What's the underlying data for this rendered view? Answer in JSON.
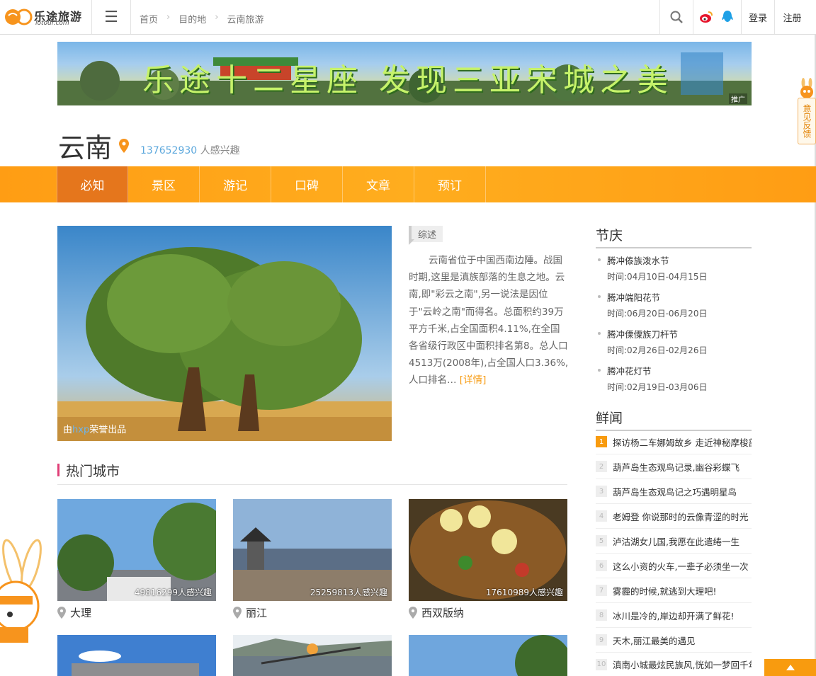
{
  "header": {
    "logo_text": "乐途旅游",
    "logo_sub": "lotour.com",
    "breadcrumb": [
      "首页",
      "目的地",
      "云南旅游"
    ],
    "login": "登录",
    "register": "注册"
  },
  "banner": {
    "text": "乐途十二星座 发现三亚宋城之美",
    "tag": "推广"
  },
  "destination": {
    "name": "云南",
    "interest_count": "137652930",
    "interest_label": "人感兴趣"
  },
  "nav": {
    "items": [
      "必知",
      "景区",
      "游记",
      "口碑",
      "文章",
      "预订"
    ],
    "active": 0
  },
  "main_photo": {
    "credit_prefix": "由",
    "credit_user": "hxp",
    "credit_suffix": "荣誉出品"
  },
  "overview": {
    "tag": "综述",
    "text": "云南省位于中国西南边陲。战国时期,这里是滇族部落的生息之地。云南,即\"彩云之南\",另一说法是因位于\"云岭之南\"而得名。总面积约39万平方千米,占全国面积4.11%,在全国各省级行政区中面积排名第8。总人口4513万(2008年),占全国人口3.36%,人口排名…",
    "more": "[详情]"
  },
  "hot_cities": {
    "title": "热门城市",
    "items": [
      {
        "name": "大理",
        "count": "49816299人感兴趣"
      },
      {
        "name": "丽江",
        "count": "25259813人感兴趣"
      },
      {
        "name": "西双版纳",
        "count": "17610989人感兴趣"
      }
    ]
  },
  "festivals": {
    "title": "节庆",
    "items": [
      {
        "name": "腾冲傣族泼水节",
        "time": "时间:04月10日-04月15日"
      },
      {
        "name": "腾冲端阳花节",
        "time": "时间:06月20日-06月20日"
      },
      {
        "name": "腾冲傈僳族刀杆节",
        "time": "时间:02月26日-02月26日"
      },
      {
        "name": "腾冲花灯节",
        "time": "时间:02月19日-03月06日"
      }
    ]
  },
  "news": {
    "title": "鲜闻",
    "items": [
      {
        "num": "1",
        "text": "探访杨二车娜姆故乡 走近神秘摩梭部落"
      },
      {
        "num": "2",
        "text": "葫芦岛生态观鸟记录,幽谷彩蝶飞"
      },
      {
        "num": "3",
        "text": "葫芦岛生态观鸟记之巧遇明星鸟"
      },
      {
        "num": "4",
        "text": "老姆登 你说那时的云像青涩的时光"
      },
      {
        "num": "5",
        "text": "泸沽湖女儿国,我愿在此遣绻一生"
      },
      {
        "num": "6",
        "text": "这么小资的火车,一辈子必须坐一次"
      },
      {
        "num": "7",
        "text": "雾霾的时候,就逃到大理吧!"
      },
      {
        "num": "8",
        "text": "冰川是冷的,岸边却开满了鲜花!"
      },
      {
        "num": "9",
        "text": "天木,丽江最美的遇见"
      },
      {
        "num": "10",
        "text": "滇南小城最炫民族风,恍如一梦回千年"
      }
    ]
  },
  "feedback": {
    "label": "意见反馈"
  },
  "colors": {
    "accent": "#ff9d14",
    "active": "#e5761c",
    "link": "#5ea9dd"
  }
}
